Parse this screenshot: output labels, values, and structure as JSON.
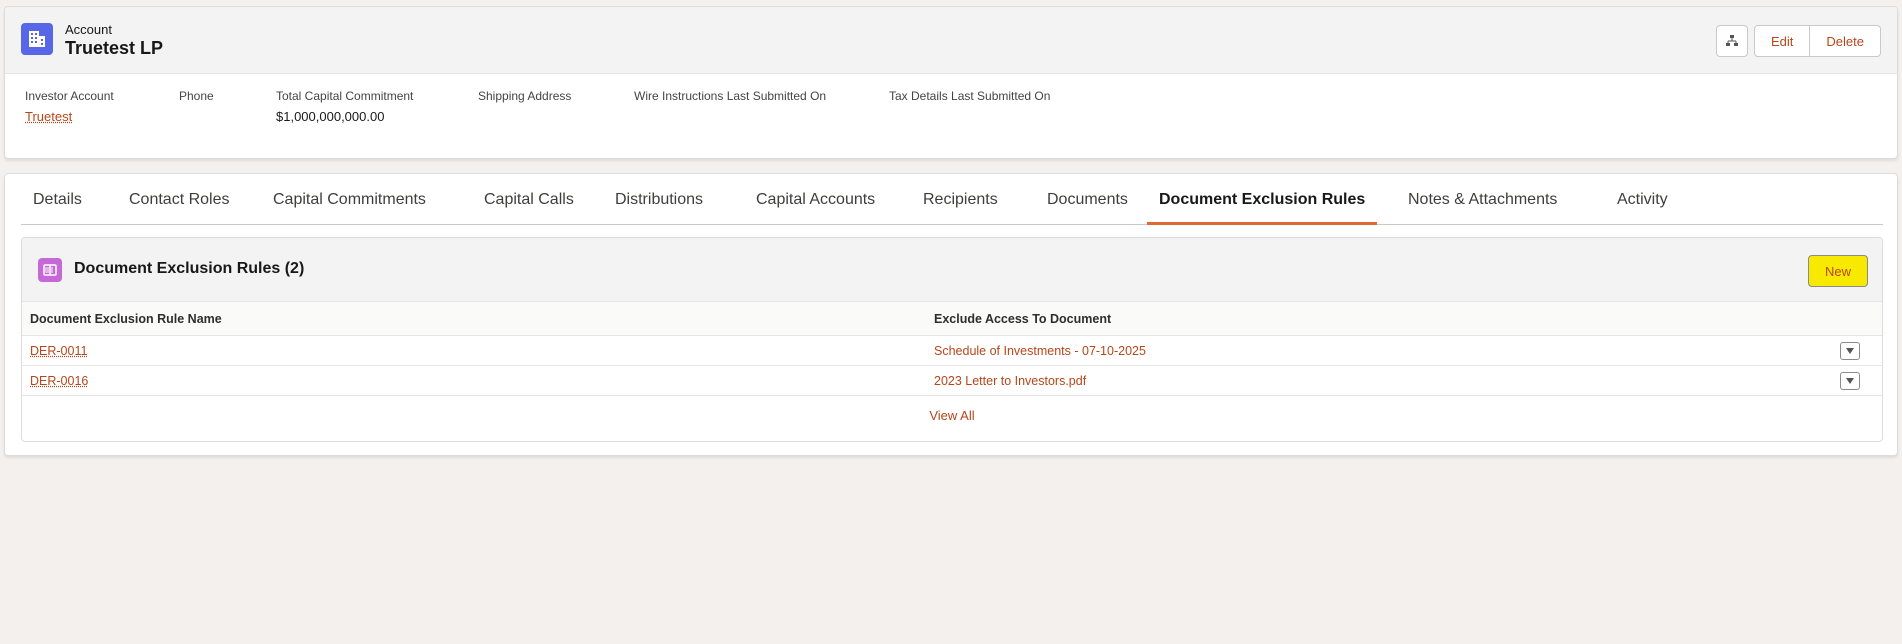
{
  "record": {
    "object_label": "Account",
    "name": "Truetest LP",
    "actions": {
      "hierarchy_icon": "hierarchy-icon",
      "edit": "Edit",
      "delete": "Delete"
    }
  },
  "highlights": [
    {
      "label": "Investor Account",
      "value": "Truetest",
      "is_link": true
    },
    {
      "label": "Phone",
      "value": ""
    },
    {
      "label": "Total Capital Commitment",
      "value": "$1,000,000,000.00"
    },
    {
      "label": "Shipping Address",
      "value": ""
    },
    {
      "label": "Wire Instructions Last Submitted On",
      "value": ""
    },
    {
      "label": "Tax Details Last Submitted On",
      "value": ""
    }
  ],
  "tabs": [
    {
      "label": "Details"
    },
    {
      "label": "Contact Roles"
    },
    {
      "label": "Capital Commitments"
    },
    {
      "label": "Capital Calls"
    },
    {
      "label": "Distributions"
    },
    {
      "label": "Capital Accounts"
    },
    {
      "label": "Recipients"
    },
    {
      "label": "Documents"
    },
    {
      "label": "Document Exclusion Rules",
      "active": true
    },
    {
      "label": "Notes & Attachments"
    },
    {
      "label": "Activity"
    }
  ],
  "related_list": {
    "title": "Document Exclusion Rules (2)",
    "icon": "book-icon",
    "new_label": "New",
    "columns": [
      "Document Exclusion Rule Name",
      "Exclude Access To Document"
    ],
    "rows": [
      {
        "name": "DER-0011",
        "document": "Schedule of Investments - 07-10-2025"
      },
      {
        "name": "DER-0016",
        "document": "2023 Letter to Investors.pdf"
      }
    ],
    "view_all": "View All"
  },
  "colors": {
    "link": "#b6461a",
    "account_icon_bg": "#5867e8",
    "related_icon_bg": "#c768d8",
    "active_tab_underline": "#e06933",
    "new_button_highlight": "#f7ea00"
  }
}
